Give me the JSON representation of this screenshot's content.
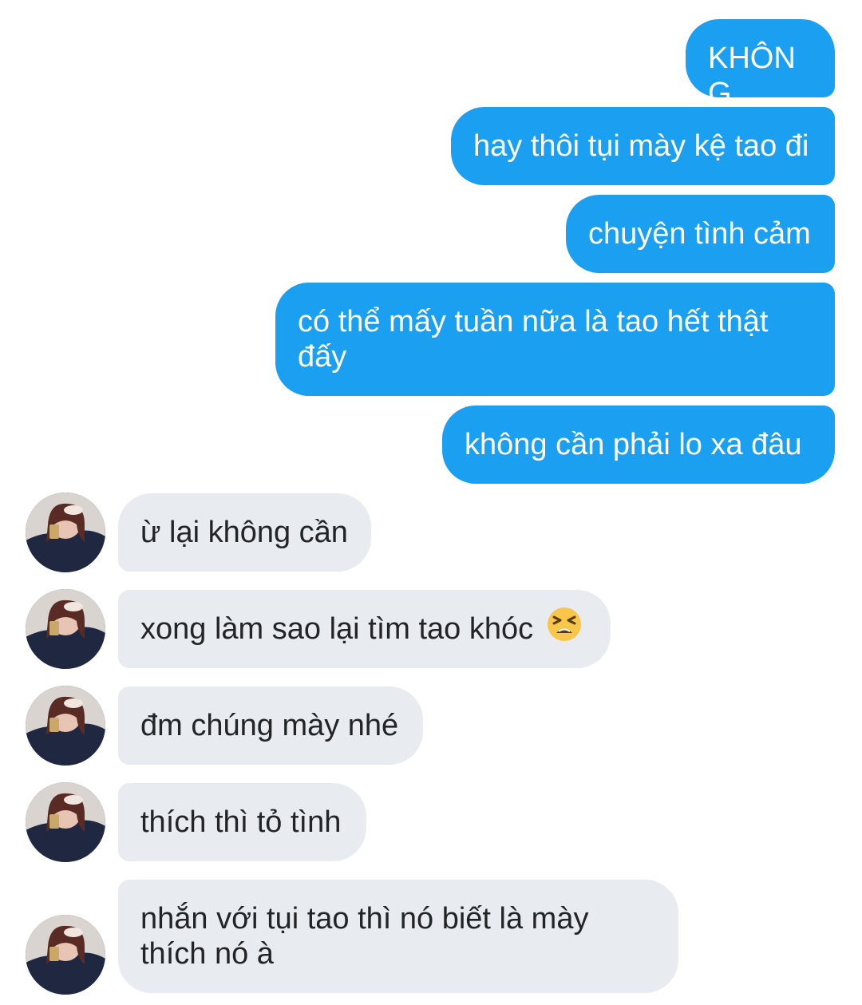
{
  "theme": {
    "outgoing_color": "#1b9ff1",
    "incoming_color": "#e8ebef",
    "outgoing_text": "#ffffff",
    "incoming_text": "#222427"
  },
  "messages": {
    "outgoing": [
      "KHÔNG",
      "hay thôi tụi mày kệ tao đi",
      "chuyện tình cảm",
      "có thể mấy tuần nữa là tao hết thật đấy",
      "không cần phải lo xa đâu"
    ],
    "incoming": [
      "ừ lại không cần",
      "xong làm sao lại tìm tao khóc",
      "đm chúng mày nhé",
      "thích thì tỏ tình",
      "nhắn với tụi tao thì nó biết là mày thích nó à"
    ]
  },
  "icons": {
    "avatar": "contact-avatar-photo",
    "emoji": "tired-face-emoji"
  }
}
